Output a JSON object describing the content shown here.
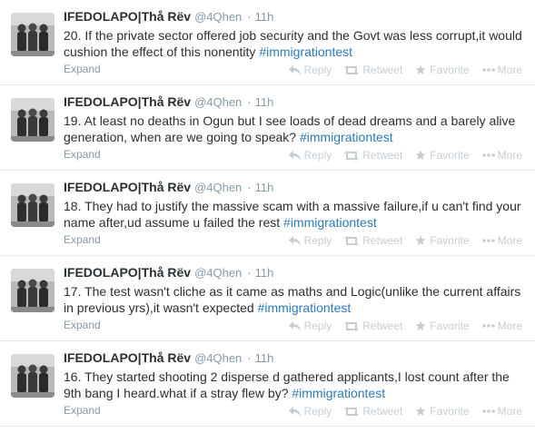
{
  "tweets": [
    {
      "name": "IFEDOLAPO|Thå Rëv",
      "handle": "@4Qhen",
      "time": "11h",
      "text_before": "20. If the private sector offered job security and the Govt was less corrupt,it would cushion the effect of this nonentity ",
      "hashtag": "#immigrationtest",
      "expand": "Expand",
      "actions": {
        "reply": "Reply",
        "retweet": "Retweet",
        "favorite": "Favorite",
        "more": "More"
      }
    },
    {
      "name": "IFEDOLAPO|Thå Rëv",
      "handle": "@4Qhen",
      "time": "11h",
      "text_before": "19. At least no deaths in Ogun but I see loads of dead dreams and a barely alive generation, when are we going to speak? ",
      "hashtag": "#immigrationtest",
      "expand": "Expand",
      "actions": {
        "reply": "Reply",
        "retweet": "Retweet",
        "favorite": "Favorite",
        "more": "More"
      }
    },
    {
      "name": "IFEDOLAPO|Thå Rëv",
      "handle": "@4Qhen",
      "time": "11h",
      "text_before": "18. They had to justify the massive scam with a massive failure,if u can't find your name after,ud assume u failed the rest ",
      "hashtag": "#immigrationtest",
      "expand": "Expand",
      "actions": {
        "reply": "Reply",
        "retweet": "Retweet",
        "favorite": "Favorite",
        "more": "More"
      }
    },
    {
      "name": "IFEDOLAPO|Thå Rëv",
      "handle": "@4Qhen",
      "time": "11h",
      "text_before": "17. The test wasn't cliche as it came as maths and Logic(unlike the current affairs in previous yrs),it wasn't expected ",
      "hashtag": "#immigrationtest",
      "expand": "Expand",
      "actions": {
        "reply": "Reply",
        "retweet": "Retweet",
        "favorite": "Favorite",
        "more": "More"
      }
    },
    {
      "name": "IFEDOLAPO|Thå Rëv",
      "handle": "@4Qhen",
      "time": "11h",
      "text_before": "16. They started shooting 2 disperse d gathered applicants,I lost count after the 9th bang I heard.what if a stray flew by? ",
      "hashtag": "#immigrationtest",
      "expand": "Expand",
      "actions": {
        "reply": "Reply",
        "retweet": "Retweet",
        "favorite": "Favorite",
        "more": "More"
      }
    }
  ],
  "colors": {
    "hashtag": "#2b7bb9",
    "muted": "#8899a6",
    "action": "#c6ced4",
    "divider": "#e1e8ed"
  },
  "icons": {
    "reply": "reply-icon",
    "retweet": "retweet-icon",
    "favorite": "star-icon",
    "more": "ellipsis-icon"
  }
}
